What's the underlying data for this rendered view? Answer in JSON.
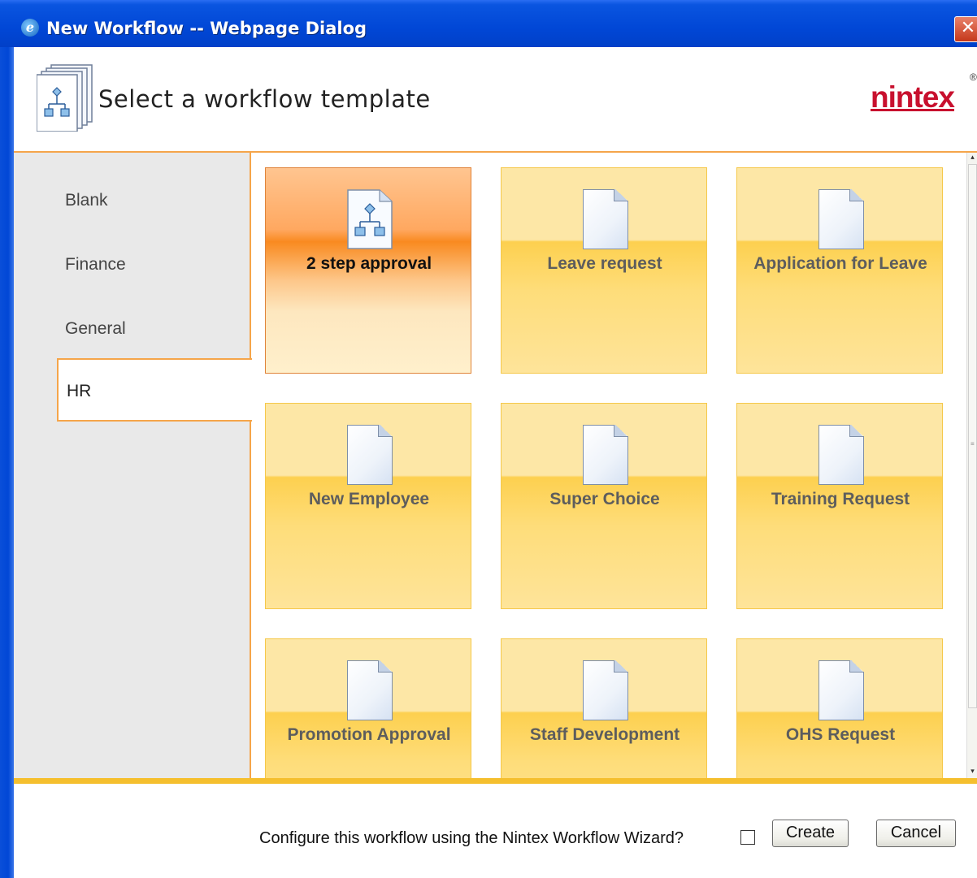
{
  "window": {
    "title": "New Workflow -- Webpage Dialog",
    "close_glyph": "✕"
  },
  "header": {
    "title": "Select a workflow template",
    "logo_text": "nintex",
    "logo_registered": "®"
  },
  "sidebar": {
    "items": [
      {
        "label": "Blank"
      },
      {
        "label": "Finance"
      },
      {
        "label": "General"
      },
      {
        "label": "HR",
        "active": true
      }
    ]
  },
  "templates": [
    {
      "label": "2 step approval",
      "icon": "workflow-icon",
      "selected": true
    },
    {
      "label": "Leave request",
      "icon": "document-icon"
    },
    {
      "label": "Application for Leave",
      "icon": "document-icon"
    },
    {
      "label": "New Employee",
      "icon": "document-icon"
    },
    {
      "label": "Super Choice",
      "icon": "document-icon"
    },
    {
      "label": "Training Request",
      "icon": "document-icon"
    },
    {
      "label": "Promotion Approval",
      "icon": "document-icon"
    },
    {
      "label": "Staff Development",
      "icon": "document-icon"
    },
    {
      "label": "OHS Request",
      "icon": "document-icon"
    }
  ],
  "footer": {
    "wizard_label": "Configure this workflow using the Nintex Workflow Wizard?",
    "wizard_checked": false,
    "create_label": "Create",
    "cancel_label": "Cancel"
  },
  "colors": {
    "accent_orange": "#f5a54a",
    "tile_yellow": "#fdd04f",
    "selected_orange": "#f98a20",
    "titlebar_blue": "#0147d6",
    "logo_red": "#c8102e"
  }
}
